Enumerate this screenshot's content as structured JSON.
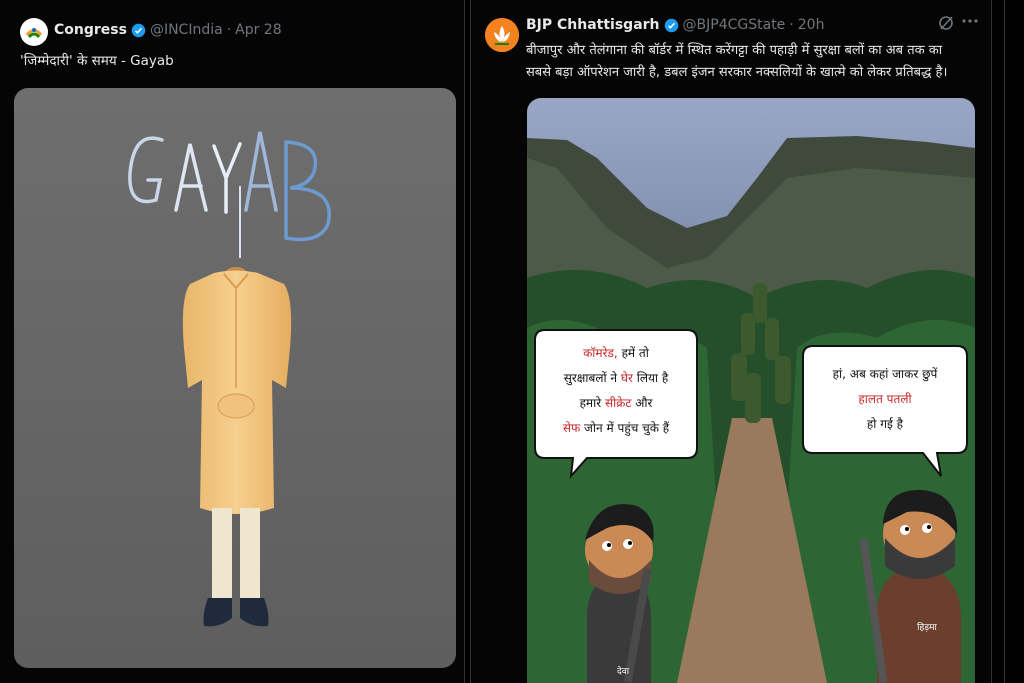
{
  "left_tweet": {
    "author_name": "Congress",
    "handle": "@INCIndia",
    "separator": "·",
    "date": "Apr 28",
    "text": "'जिम्मेदारी' के समय - Gayab",
    "image": {
      "title_word": "GAYAB",
      "background_color": "#6b6b6b",
      "kurta_color": "#f1c27d"
    }
  },
  "right_tweet": {
    "author_name": "BJP Chhattisgarh",
    "handle": "@BJP4CGState",
    "separator": "·",
    "time": "20h",
    "text_line1": "बीजापुर और तेलंगाना की बॉर्डर में स्थित करेंगट्टा की पहाड़ी में सुरक्षा बलों का अब तक का",
    "text_line2": "सबसे बड़ा ऑपरेशन जारी है, डबल इंजन सरकार नक्सलियों के खात्मे को लेकर प्रतिबद्ध है।",
    "cartoon": {
      "left_bubble": {
        "line1_red": "कॉमरेड,",
        "line1_rest": " हमें तो",
        "line2_start": "सुरक्षाबलों ने ",
        "line2_red": "घेर",
        "line2_end": " लिया है",
        "line3_start": "हमारे ",
        "line3_red": "सीक्रेट",
        "line3_end": " और",
        "line4_red": "सेफ",
        "line4_end": " जोन में पहुंच चुके हैं"
      },
      "right_bubble": {
        "line1": "हां, अब कहां जाकर छुपें",
        "line2_red": "हालत पतली",
        "line3": "हो गई है"
      },
      "left_character_label": "देवा",
      "right_character_label": "हिड़मा",
      "sky_color": "#4a5577",
      "forest_color": "#1f4d24"
    },
    "icons": [
      "grok-icon",
      "more-icon"
    ]
  },
  "colors": {
    "verified": "#1d9bf0",
    "congress_avatar": "#ffffff",
    "bjp_avatar": "#f58220"
  }
}
